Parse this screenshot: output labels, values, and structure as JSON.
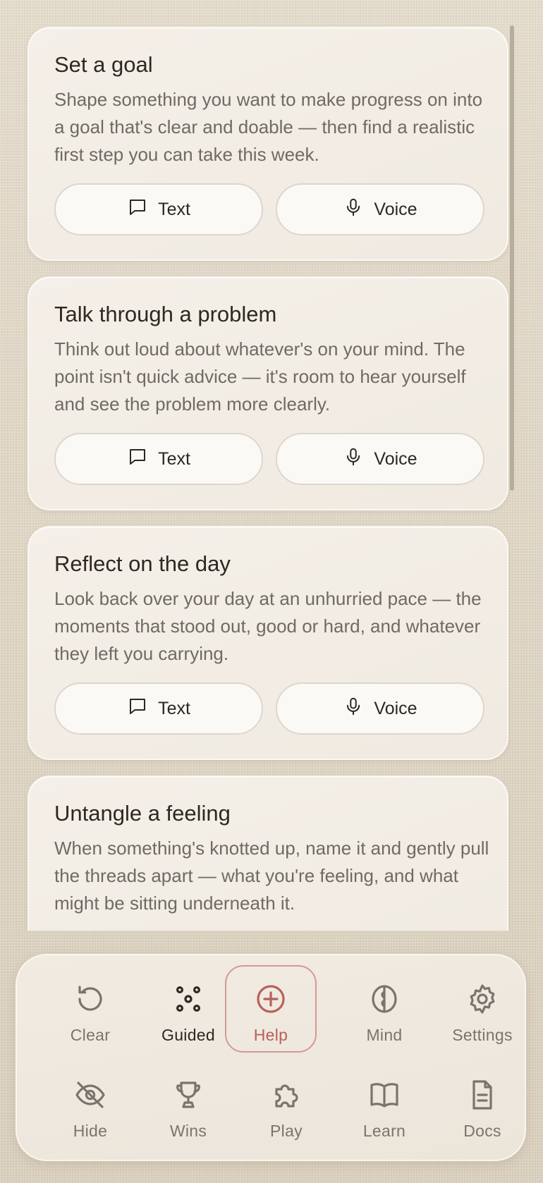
{
  "cards": [
    {
      "title": "Set a goal",
      "description": "Shape something you want to make progress on into a goal that's clear and doable — then find a realistic first step you can take this week.",
      "text_label": "Text",
      "voice_label": "Voice"
    },
    {
      "title": "Talk through a problem",
      "description": "Think out loud about whatever's on your mind. The point isn't quick advice — it's room to hear yourself and see the problem more clearly.",
      "text_label": "Text",
      "voice_label": "Voice"
    },
    {
      "title": "Reflect on the day",
      "description": "Look back over your day at an unhurried pace — the moments that stood out, good or hard, and whatever they left you carrying.",
      "text_label": "Text",
      "voice_label": "Voice"
    },
    {
      "title": "Untangle a feeling",
      "description": "When something's knotted up, name it and gently pull the threads apart — what you're feeling, and what might be sitting underneath it."
    }
  ],
  "dock": {
    "row1": [
      {
        "label": "Clear",
        "icon": "refresh-icon"
      },
      {
        "label": "Guided",
        "icon": "dots-icon"
      },
      {
        "label": "Help",
        "icon": "plus-circle-icon"
      },
      {
        "label": "Mind",
        "icon": "brain-icon"
      },
      {
        "label": "Settings",
        "icon": "gear-icon"
      }
    ],
    "row2": [
      {
        "label": "Hide",
        "icon": "eye-off-icon"
      },
      {
        "label": "Wins",
        "icon": "trophy-icon"
      },
      {
        "label": "Play",
        "icon": "puzzle-icon"
      },
      {
        "label": "Learn",
        "icon": "book-icon"
      },
      {
        "label": "Docs",
        "icon": "document-icon"
      }
    ]
  },
  "colors": {
    "accent": "#b9605a",
    "help_border": "#d29a93",
    "muted_text": "#7a746d",
    "background": "#e3dac9"
  }
}
